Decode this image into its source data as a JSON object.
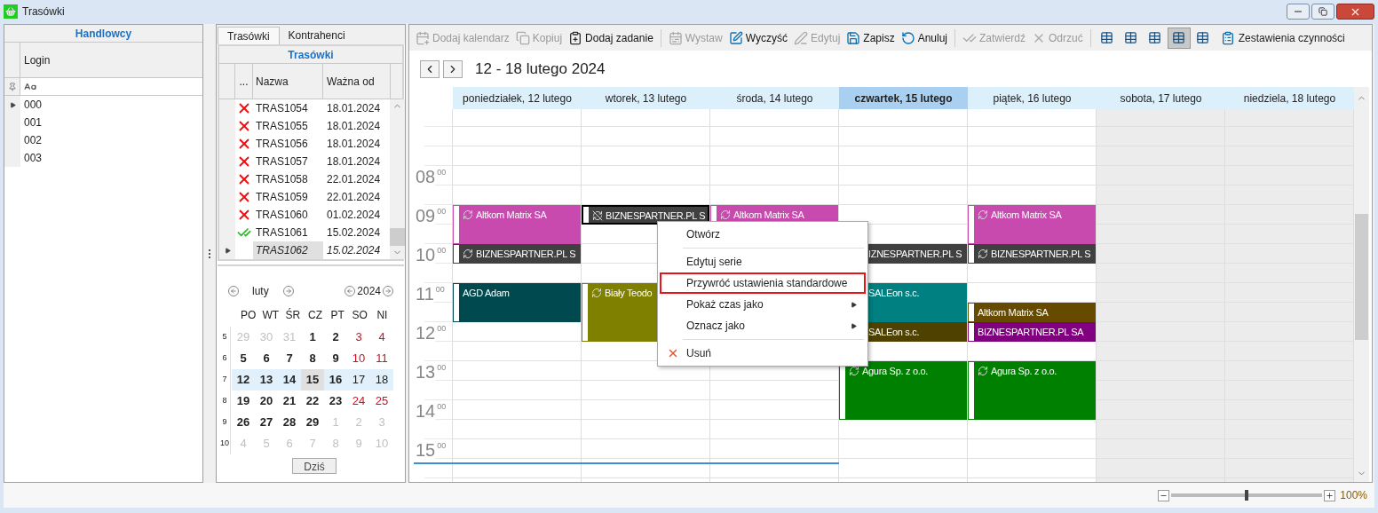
{
  "window": {
    "title": "Trasówki"
  },
  "salespeople": {
    "title": "Handlowcy",
    "column": "Login",
    "rows": [
      {
        "login": "000",
        "selected": true
      },
      {
        "login": "001",
        "selected": false
      },
      {
        "login": "002",
        "selected": false
      },
      {
        "login": "003",
        "selected": false
      }
    ]
  },
  "routes": {
    "tabs": [
      {
        "label": "Trasówki",
        "selected": true
      },
      {
        "label": "Kontrahenci",
        "selected": false
      }
    ],
    "title": "Trasówki",
    "columns": [
      "...",
      "Nazwa",
      "Ważna od"
    ],
    "rows": [
      {
        "kind": "rejected",
        "name": "TRAS1054",
        "valid_from": "18.01.2024",
        "selected": false
      },
      {
        "kind": "rejected",
        "name": "TRAS1055",
        "valid_from": "18.01.2024",
        "selected": false
      },
      {
        "kind": "rejected",
        "name": "TRAS1056",
        "valid_from": "18.01.2024",
        "selected": false
      },
      {
        "kind": "rejected",
        "name": "TRAS1057",
        "valid_from": "18.01.2024",
        "selected": false
      },
      {
        "kind": "rejected",
        "name": "TRAS1058",
        "valid_from": "22.01.2024",
        "selected": false
      },
      {
        "kind": "rejected",
        "name": "TRAS1059",
        "valid_from": "22.01.2024",
        "selected": false
      },
      {
        "kind": "rejected",
        "name": "TRAS1060",
        "valid_from": "01.02.2024",
        "selected": false
      },
      {
        "kind": "approved",
        "name": "TRAS1061",
        "valid_from": "15.02.2024",
        "selected": false
      },
      {
        "kind": "plain",
        "name": "TRAS1062",
        "valid_from": "15.02.2024",
        "selected": true
      }
    ]
  },
  "mini_calendar": {
    "month": "luty",
    "year": "2024",
    "weekdays": [
      "PO",
      "WT",
      "ŚR",
      "CZ",
      "PT",
      "SO",
      "NI"
    ],
    "weeks": [
      {
        "number": "5",
        "selected": false,
        "days": [
          {
            "day": "29",
            "kind": "other"
          },
          {
            "day": "30",
            "kind": "other"
          },
          {
            "day": "31",
            "kind": "other"
          },
          {
            "day": "1",
            "kind": "weekday"
          },
          {
            "day": "2",
            "kind": "weekday"
          },
          {
            "day": "3",
            "kind": "weekend"
          },
          {
            "day": "4",
            "kind": "weekend"
          }
        ]
      },
      {
        "number": "6",
        "selected": false,
        "days": [
          {
            "day": "5",
            "kind": "weekday"
          },
          {
            "day": "6",
            "kind": "weekday"
          },
          {
            "day": "7",
            "kind": "weekday"
          },
          {
            "day": "8",
            "kind": "weekday"
          },
          {
            "day": "9",
            "kind": "weekday"
          },
          {
            "day": "10",
            "kind": "weekend"
          },
          {
            "day": "11",
            "kind": "weekend"
          }
        ]
      },
      {
        "number": "7",
        "selected": true,
        "days": [
          {
            "day": "12",
            "kind": "weekday"
          },
          {
            "day": "13",
            "kind": "weekday"
          },
          {
            "day": "14",
            "kind": "weekday"
          },
          {
            "day": "15",
            "kind": "today"
          },
          {
            "day": "16",
            "kind": "weekday"
          },
          {
            "day": "17",
            "kind": "weekend"
          },
          {
            "day": "18",
            "kind": "weekend"
          }
        ]
      },
      {
        "number": "8",
        "selected": false,
        "days": [
          {
            "day": "19",
            "kind": "weekday"
          },
          {
            "day": "20",
            "kind": "weekday"
          },
          {
            "day": "21",
            "kind": "weekday"
          },
          {
            "day": "22",
            "kind": "weekday"
          },
          {
            "day": "23",
            "kind": "weekday"
          },
          {
            "day": "24",
            "kind": "weekend"
          },
          {
            "day": "25",
            "kind": "weekend"
          }
        ]
      },
      {
        "number": "9",
        "selected": false,
        "days": [
          {
            "day": "26",
            "kind": "weekday"
          },
          {
            "day": "27",
            "kind": "weekday"
          },
          {
            "day": "28",
            "kind": "weekday"
          },
          {
            "day": "29",
            "kind": "weekday"
          },
          {
            "day": "1",
            "kind": "other"
          },
          {
            "day": "2",
            "kind": "other"
          },
          {
            "day": "3",
            "kind": "other"
          }
        ]
      },
      {
        "number": "10",
        "selected": false,
        "days": [
          {
            "day": "4",
            "kind": "other"
          },
          {
            "day": "5",
            "kind": "other"
          },
          {
            "day": "6",
            "kind": "other"
          },
          {
            "day": "7",
            "kind": "other"
          },
          {
            "day": "8",
            "kind": "other"
          },
          {
            "day": "9",
            "kind": "other"
          },
          {
            "day": "10",
            "kind": "other"
          }
        ]
      }
    ],
    "today_button": "Dziś"
  },
  "toolbar": {
    "groups": [
      [
        {
          "label": "Dodaj kalendarz",
          "disabled": true
        },
        {
          "label": "Kopiuj",
          "disabled": true
        },
        {
          "label": "Dodaj zadanie",
          "disabled": false
        }
      ],
      [
        {
          "label": "Wystaw",
          "disabled": true
        },
        {
          "label": "Wyczyść",
          "disabled": false
        },
        {
          "label": "Edytuj",
          "disabled": true
        },
        {
          "label": "Zapisz",
          "disabled": false
        },
        {
          "label": "Anuluj",
          "disabled": false
        }
      ],
      [
        {
          "label": "Zatwierdź",
          "disabled": true
        },
        {
          "label": "Odrzuć",
          "disabled": true
        }
      ]
    ],
    "views": [
      {
        "selected": false
      },
      {
        "selected": false
      },
      {
        "selected": false
      },
      {
        "selected": true
      },
      {
        "selected": false
      }
    ],
    "report": {
      "label": "Zestawienia czynności"
    }
  },
  "calendar": {
    "range": "12 - 18 lutego 2024",
    "hours": [
      {
        "hour": "08",
        "minutes": "00"
      },
      {
        "hour": "09",
        "minutes": "00"
      },
      {
        "hour": "10",
        "minutes": "00"
      },
      {
        "hour": "11",
        "minutes": "00"
      },
      {
        "hour": "12",
        "minutes": "00"
      },
      {
        "hour": "13",
        "minutes": "00"
      },
      {
        "hour": "14",
        "minutes": "00"
      },
      {
        "hour": "15",
        "minutes": "00"
      }
    ],
    "days": [
      {
        "label": "poniedziałek, 12 lutego",
        "selected": false,
        "weekend": false,
        "events": [
          {
            "title": "Altkom Matrix SA",
            "color": "#c84aae",
            "kind": "recurring",
            "selected": false
          },
          {
            "title": "BIZNESPARTNER.PL S",
            "color": "#404040",
            "kind": "recurring",
            "selected": false
          },
          {
            "title": "AGD Adam",
            "color": "#004a4f",
            "kind": "single",
            "selected": false
          }
        ]
      },
      {
        "label": "wtorek, 13 lutego",
        "selected": false,
        "weekend": false,
        "events": [
          {
            "title": "BIZNESPARTNER.PL S",
            "color": "#404040",
            "kind": "exception",
            "selected": true
          },
          {
            "title": "Biały Teodo",
            "color": "#808000",
            "kind": "recurring",
            "selected": false
          }
        ]
      },
      {
        "label": "środa, 14 lutego",
        "selected": false,
        "weekend": false,
        "events": [
          {
            "title": "Altkom Matrix SA",
            "color": "#c84aae",
            "kind": "recurring",
            "selected": false
          }
        ]
      },
      {
        "label": "czwartek, 15 lutego",
        "selected": true,
        "weekend": false,
        "events": [
          {
            "title": "IZNESPARTNER.PL S",
            "color": "#404040",
            "kind": "covered",
            "selected": false
          },
          {
            "title": "SALEon s.c.",
            "color": "#008080",
            "kind": "covered",
            "selected": false
          },
          {
            "title": "SALEon s.c.",
            "color": "#4f4200",
            "kind": "covered",
            "selected": false
          },
          {
            "title": "Agura Sp. z o.o.",
            "color": "#008000",
            "kind": "recurring",
            "selected": false
          }
        ]
      },
      {
        "label": "piątek, 16 lutego",
        "selected": false,
        "weekend": false,
        "events": [
          {
            "title": "Altkom Matrix SA",
            "color": "#c84aae",
            "kind": "recurring",
            "selected": false
          },
          {
            "title": "BIZNESPARTNER.PL S",
            "color": "#404040",
            "kind": "recurring",
            "selected": false
          },
          {
            "title": "Altkom Matrix SA",
            "color": "#664a00",
            "kind": "single",
            "selected": false
          },
          {
            "title": "BIZNESPARTNER.PL SA",
            "color": "#800080",
            "kind": "single",
            "selected": false
          },
          {
            "title": "Agura Sp. z o.o.",
            "color": "#008000",
            "kind": "recurring",
            "selected": false
          }
        ]
      },
      {
        "label": "sobota, 17 lutego",
        "selected": false,
        "weekend": true
      },
      {
        "label": "niedziela, 18 lutego",
        "selected": false,
        "weekend": true
      }
    ]
  },
  "context_menu": {
    "items": [
      {
        "kind": "item",
        "label": "Otwórz",
        "highlighted": false
      },
      {
        "kind": "separator"
      },
      {
        "kind": "item",
        "label": "Edytuj serie",
        "highlighted": false
      },
      {
        "kind": "item",
        "label": "Przywróć ustawienia standardowe",
        "highlighted": true
      },
      {
        "kind": "submenu",
        "label": "Pokaż czas jako",
        "highlighted": false
      },
      {
        "kind": "submenu",
        "label": "Oznacz jako",
        "highlighted": false
      },
      {
        "kind": "separator"
      },
      {
        "kind": "delete",
        "label": "Usuń",
        "highlighted": false
      }
    ]
  },
  "zoom": {
    "level": 0.5,
    "reading": "100%"
  }
}
